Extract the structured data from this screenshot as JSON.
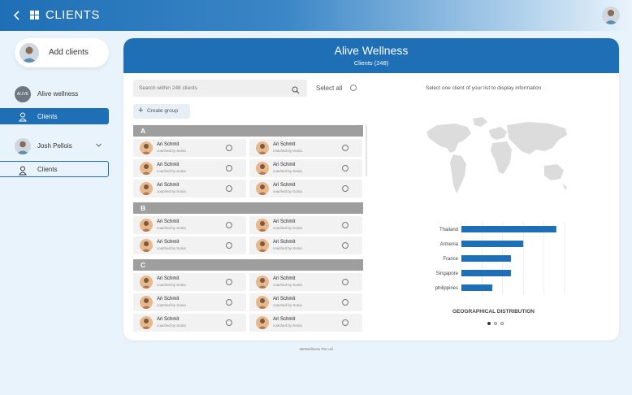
{
  "header": {
    "title": "CLIENTS"
  },
  "sidebar": {
    "add_clients_label": "Add clients",
    "org_logo_text": "ALIVE",
    "org_name": "Alive wellness",
    "nav_clients_1": "Clients",
    "coach_name": "Josh Pellois",
    "nav_clients_2": "Clients"
  },
  "card": {
    "title": "Alive Wellness",
    "subtitle": "Clients (248)",
    "search_placeholder": "Search within 248 clients",
    "select_all": "Select all",
    "create_group": "Create group",
    "right_hint": "Select one client of your list to display information",
    "sections": [
      {
        "letter": "A",
        "rows": [
          [
            {
              "name": "Ari Schmit",
              "coach": "coached by Sonia"
            },
            {
              "name": "Ari Schmit",
              "coach": "coached by Sonia"
            }
          ],
          [
            {
              "name": "Ari Schmit",
              "coach": "coached by Sonia"
            },
            {
              "name": "Ari Schmit",
              "coach": "coached by Sonia"
            }
          ],
          [
            {
              "name": "Ari Schmit",
              "coach": "coached by Sonia"
            },
            {
              "name": "Ari Schmit",
              "coach": "coached by Sonia"
            }
          ]
        ]
      },
      {
        "letter": "B",
        "rows": [
          [
            {
              "name": "Ari Schmit",
              "coach": "coached by Sonia"
            },
            {
              "name": "Ari Schmit",
              "coach": "coached by Sonia"
            }
          ],
          [
            {
              "name": "Ari Schmit",
              "coach": "coached by Sonia"
            },
            {
              "name": "Ari Schmit",
              "coach": "coached by Sonia"
            }
          ]
        ]
      },
      {
        "letter": "C",
        "rows": [
          [
            {
              "name": "Ari Schmit",
              "coach": "coached by Sonia"
            },
            {
              "name": "Ari Schmit",
              "coach": "coached by Sonia"
            }
          ],
          [
            {
              "name": "Ari Schmit",
              "coach": "coached by Sonia"
            },
            {
              "name": "Ari Schmit",
              "coach": "coached by Sonia"
            }
          ],
          [
            {
              "name": "Ari Schmit",
              "coach": "coached by Sonia"
            },
            {
              "name": "Ari Schmit",
              "coach": "coached by Sonia"
            }
          ]
        ]
      }
    ]
  },
  "chart_data": {
    "type": "bar",
    "orientation": "horizontal",
    "categories": [
      "Thailand",
      "Armenia",
      "France",
      "Singapore",
      "philippines"
    ],
    "values": [
      23,
      15,
      12,
      12,
      7.5
    ],
    "x_ticks": [
      "0%",
      "5%",
      "10%",
      "15%",
      "20%",
      "25%"
    ],
    "xlim": [
      0,
      25
    ],
    "title": "GEOGRAPHICAL DISTRIBUTION",
    "grid": true,
    "bar_color": "#1f6fb6"
  },
  "pagination": {
    "count": 3,
    "active": 0
  },
  "footer": {
    "text": "360Wellness Pte Ltd"
  },
  "colors": {
    "primary": "#1f6fb6",
    "section_header": "#9e9e9e",
    "background": "#e9f3fb"
  }
}
